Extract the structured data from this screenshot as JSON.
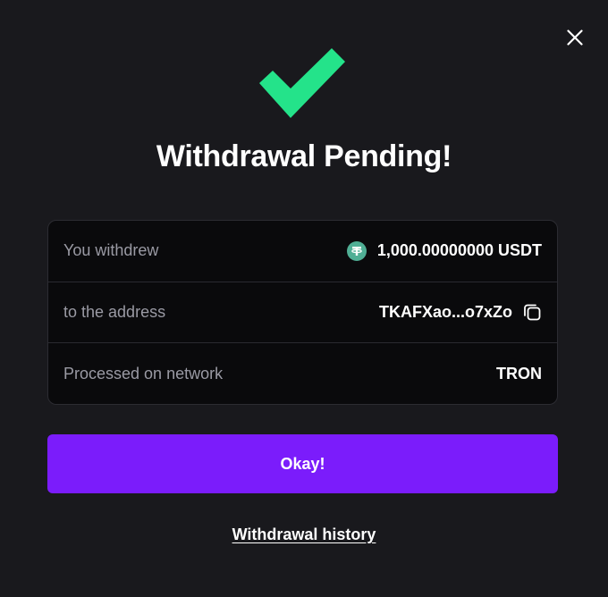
{
  "title": "Withdrawal Pending!",
  "details": {
    "rows": [
      {
        "label": "You withdrew",
        "value": "1,000.00000000 USDT",
        "icon": "usdt-icon"
      },
      {
        "label": "to the address",
        "value": "TKAFXao...o7xZo",
        "icon": "copy-icon"
      },
      {
        "label": "Processed on network",
        "value": "TRON"
      }
    ]
  },
  "actions": {
    "okay_label": "Okay!",
    "history_label": "Withdrawal history"
  },
  "colors": {
    "background": "#19191d",
    "success": "#24e38a",
    "accent": "#7b1cfb",
    "usdt": "#50af95"
  }
}
